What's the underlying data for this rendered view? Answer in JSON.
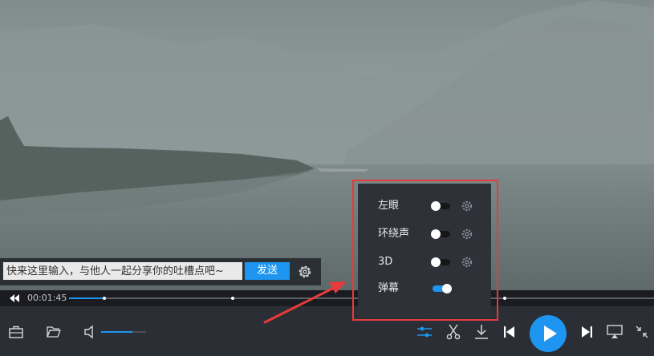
{
  "colors": {
    "accent": "#1e95f0",
    "annotation": "#e63b3b",
    "panel": "#2e3138",
    "control_bar": "#2b2e35"
  },
  "danmaku": {
    "placeholder": "快来这里输入，与他人一起分享你的吐槽点吧~",
    "send_label": "发送",
    "settings_icon": "gear-icon"
  },
  "player": {
    "current_time": "00:01:45",
    "progress_fraction": 0.06,
    "volume_fraction": 0.7,
    "icons": [
      "rewind-icon",
      "toolbox-icon",
      "folder-open-icon",
      "volume-icon",
      "equalizer-icon",
      "scissors-icon",
      "download-icon",
      "previous-icon",
      "play-icon",
      "next-icon",
      "cast-icon",
      "exit-fullscreen-icon"
    ]
  },
  "panel": {
    "rows": [
      {
        "label": "左眼",
        "on": false,
        "has_settings": true
      },
      {
        "label": "环绕声",
        "on": false,
        "has_settings": true
      },
      {
        "label": "3D",
        "on": false,
        "has_settings": true
      },
      {
        "label": "弹幕",
        "on": true,
        "has_settings": false
      }
    ]
  }
}
